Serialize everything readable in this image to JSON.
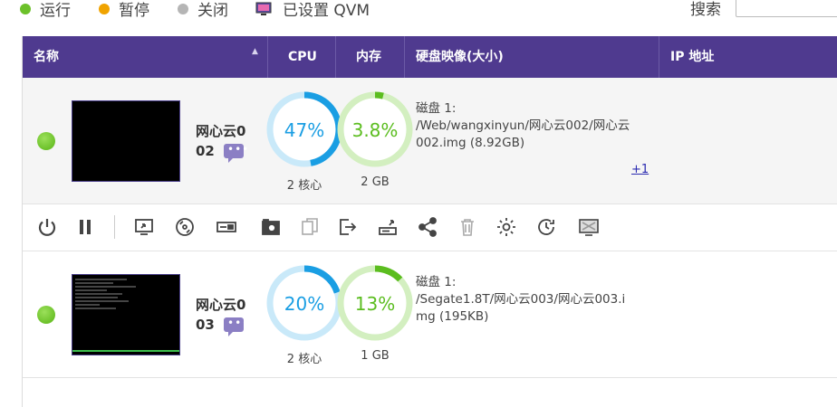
{
  "legend": [
    {
      "label": "运行",
      "color": "#6cc12a"
    },
    {
      "label": "暂停",
      "color": "#f0a300"
    },
    {
      "label": "关闭",
      "color": "#b5b5b5"
    },
    {
      "label": "已设置 QVM",
      "icon": "monitor-icon"
    }
  ],
  "search": {
    "label": "搜索",
    "placeholder": ""
  },
  "table": {
    "headers": {
      "name": "名称",
      "cpu": "CPU",
      "memory": "内存",
      "disk": "硬盘映像(大小)",
      "ip": "IP 地址"
    }
  },
  "vms": [
    {
      "name_line1": "网心云0",
      "name_line2": "02",
      "status": "running",
      "cpu_percent": 47,
      "cpu_text": "47%",
      "cpu_cores": "2 核心",
      "mem_percent": 3.8,
      "mem_text": "3.8%",
      "mem_size": "2 GB",
      "disk_line1": "磁盘 1:",
      "disk_line2": "/Web/wangxinyun/网心云002/网心云",
      "disk_line3": "002.img (8.92GB)",
      "more": "+1",
      "ip": ""
    },
    {
      "name_line1": "网心云0",
      "name_line2": "03",
      "status": "running",
      "cpu_percent": 20,
      "cpu_text": "20%",
      "cpu_cores": "2 核心",
      "mem_percent": 13,
      "mem_text": "13%",
      "mem_size": "1 GB",
      "disk_line1": "磁盘 1:",
      "disk_line2": "/Segate1.8T/网心云003/网心云003.i",
      "disk_line3": "mg (195KB)",
      "ip": ""
    }
  ],
  "actions": [
    "power-icon",
    "pause-icon",
    "console-icon",
    "disc-icon",
    "usb-icon",
    "snapshot-icon",
    "clone-icon",
    "export-icon",
    "backup-icon",
    "share-icon",
    "trash-icon",
    "settings-icon",
    "schedule-icon",
    "display-icon"
  ],
  "colors": {
    "header": "#4f3a8f",
    "cpu_ring": "#1a9ee3",
    "mem_ring": "#5bbd1f",
    "running": "#6cc12a"
  }
}
